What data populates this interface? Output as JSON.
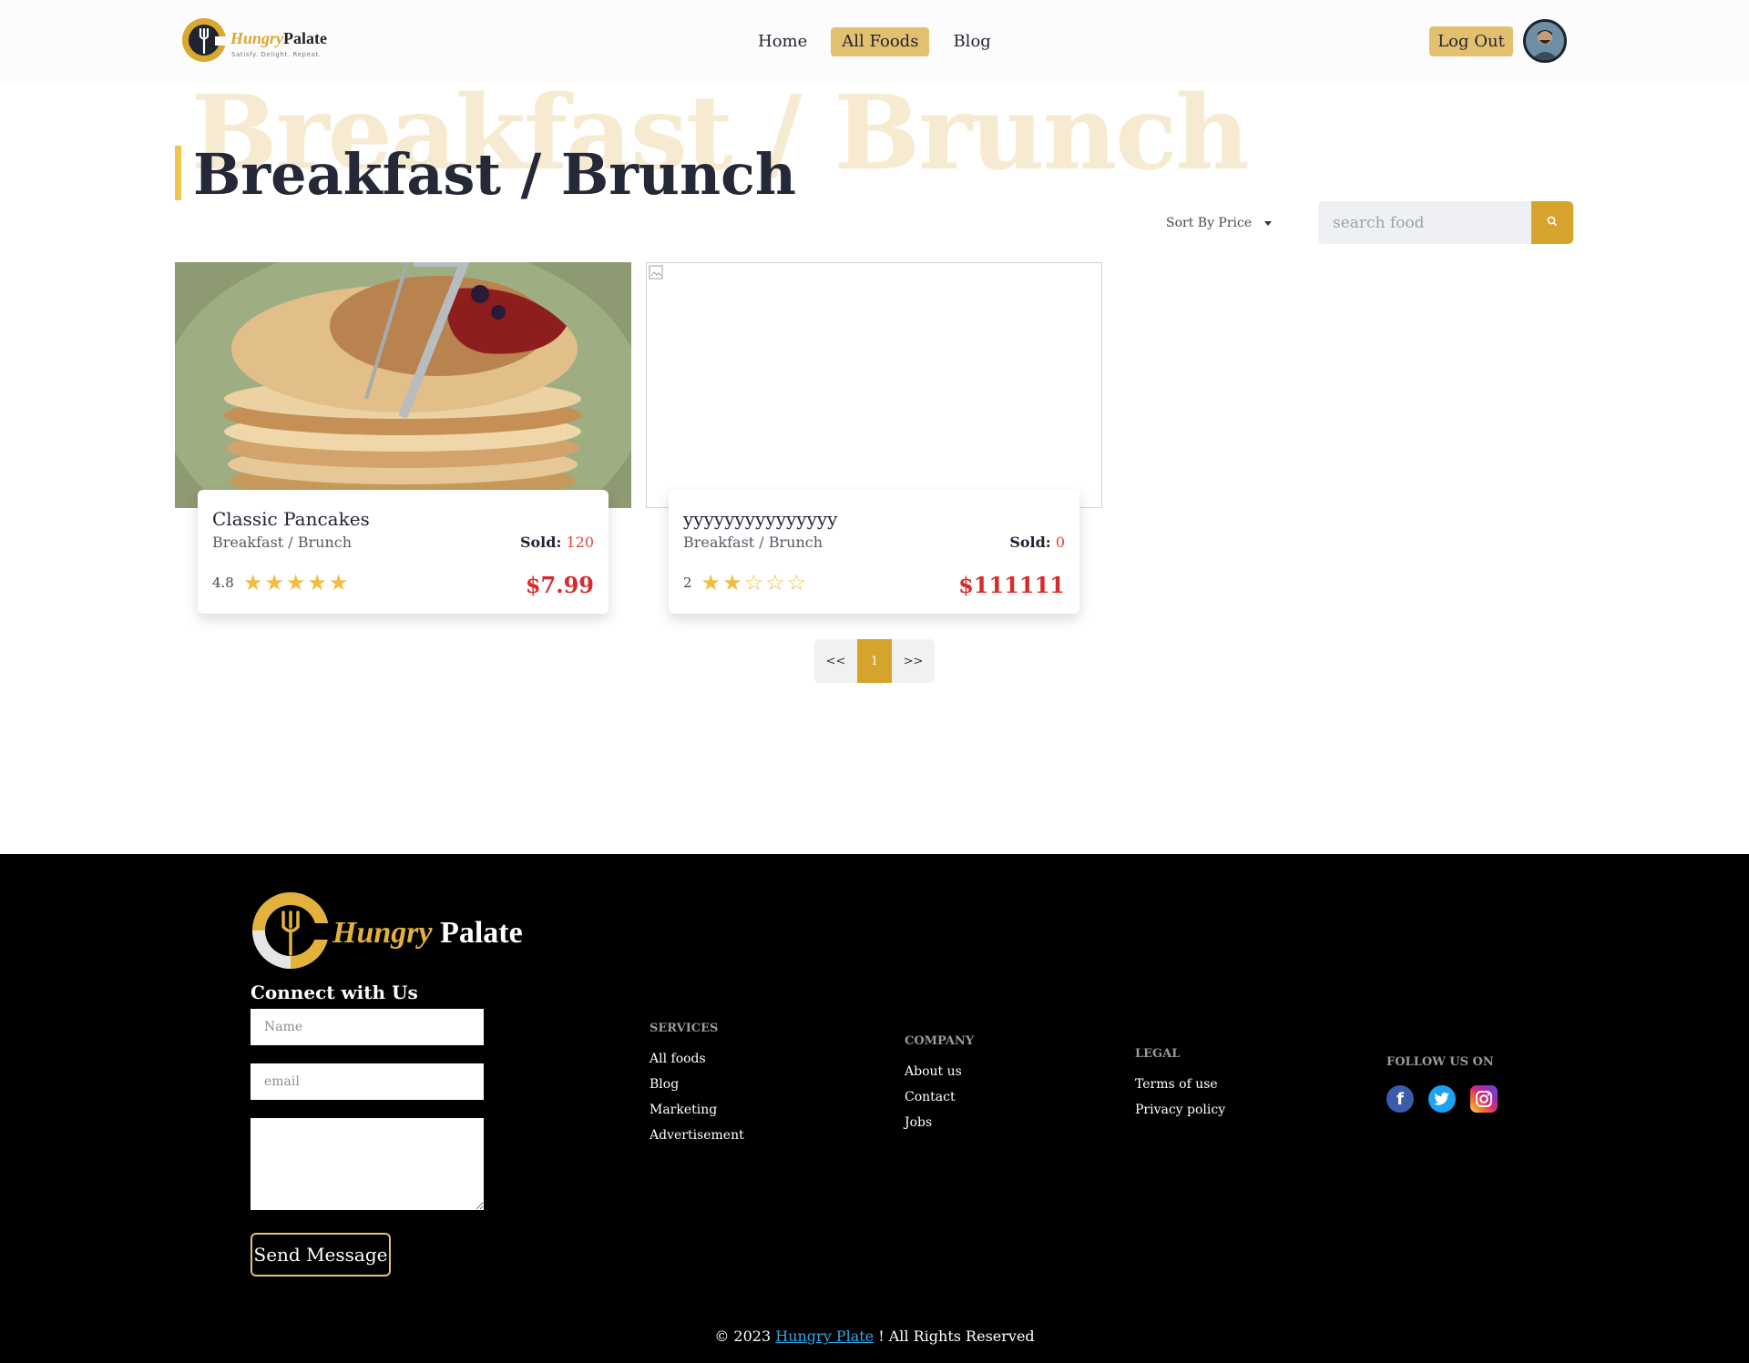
{
  "header": {
    "logo": {
      "word1": "Hungry",
      "word2": "Palate",
      "tagline": "Satisfy. Delight. Repeat."
    },
    "nav": [
      {
        "label": "Home",
        "active": false
      },
      {
        "label": "All Foods",
        "active": true
      },
      {
        "label": "Blog",
        "active": false
      }
    ],
    "logout_label": "Log Out"
  },
  "page": {
    "title": "Breakfast / Brunch",
    "sort_label": "Sort By Price",
    "search_placeholder": "search food"
  },
  "foods": [
    {
      "name": "Classic Pancakes",
      "category": "Breakfast / Brunch",
      "sold_label": "Sold:",
      "sold": "120",
      "rating": "4.8",
      "stars": 5,
      "price": "$7.99",
      "image": "pancakes"
    },
    {
      "name": "yyyyyyyyyyyyyyy",
      "category": "Breakfast / Brunch",
      "sold_label": "Sold:",
      "sold": "0",
      "rating": "2",
      "stars": 2,
      "price": "$111111",
      "image": "broken"
    }
  ],
  "pagination": {
    "prev": "<<",
    "current": "1",
    "next": ">>"
  },
  "footer": {
    "logo": {
      "word1": "Hungry",
      "word2": "Palate"
    },
    "connect_title": "Connect with Us",
    "name_placeholder": "Name",
    "email_placeholder": "email",
    "send_label": "Send Message",
    "services": {
      "title": "SERVICES",
      "links": [
        "All foods",
        "Blog",
        "Marketing",
        "Advertisement"
      ]
    },
    "company": {
      "title": "COMPANY",
      "links": [
        "About us",
        "Contact",
        "Jobs"
      ]
    },
    "legal": {
      "title": "LEGAL",
      "links": [
        "Terms of use",
        "Privacy policy"
      ]
    },
    "follow": {
      "title": "FOLLOW US ON",
      "icons": [
        "facebook-icon",
        "twitter-icon",
        "instagram-icon"
      ]
    },
    "copyright_prefix": "© 2023 ",
    "copyright_link": "Hungry Plate",
    "copyright_suffix": " ! All Rights Reserved"
  },
  "colors": {
    "accent": "#d6a42d",
    "accent_light": "#e3c070",
    "price": "#d82a2a",
    "star": "#f1bd3f"
  }
}
